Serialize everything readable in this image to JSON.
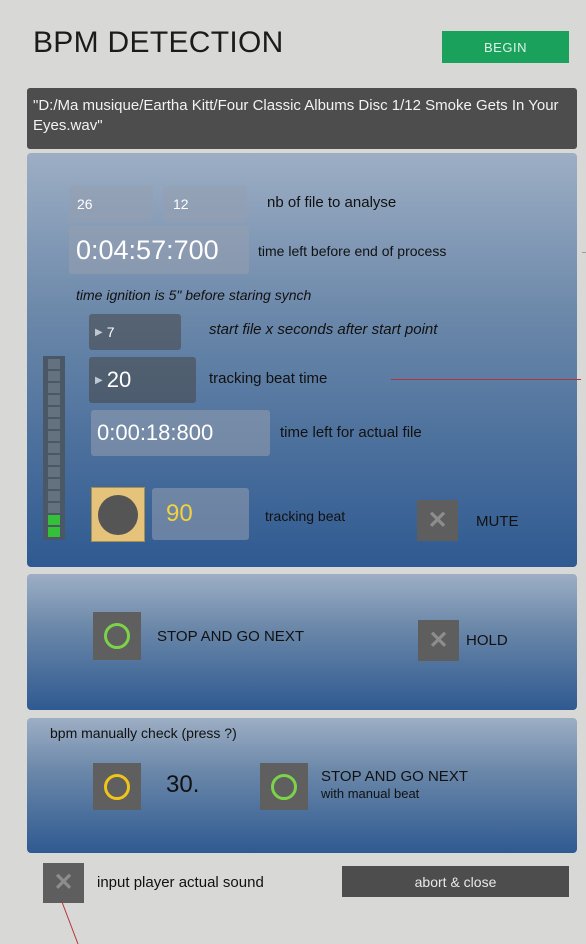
{
  "header": {
    "title": "BPM DETECTION",
    "begin_label": "BEGIN"
  },
  "file_path": "\"D:/Ma musique/Eartha Kitt/Four Classic Albums Disc 1/12 Smoke Gets In Your Eyes.wav\"",
  "analysis": {
    "total_files": "26",
    "files_to_analyse": "12",
    "nb_files_label": "nb of file to analyse",
    "time_left": "0:04:57:700",
    "time_left_label": "time left before end of process",
    "ignition_note": "time ignition is 5\" before staring synch",
    "start_offset": "7",
    "start_offset_label": "start file x seconds after start point",
    "tracking_time": "20",
    "tracking_time_label": "tracking beat time",
    "actual_file_time": "0:00:18:800",
    "actual_file_label": "time left for actual file",
    "tracking_beat_value": "90",
    "tracking_beat_label": "tracking beat",
    "mute_label": "MUTE",
    "meter_level_fraction": 0.125
  },
  "controls": {
    "stop_next_label": "STOP AND GO NEXT",
    "hold_label": "HOLD"
  },
  "manual": {
    "title": "bpm manually check (press ?)",
    "value": "30.",
    "stop_next_line1": "STOP AND GO NEXT",
    "stop_next_line2": "with manual beat"
  },
  "footer": {
    "input_label": "input player actual sound",
    "abort_label": "abort & close"
  },
  "colors": {
    "accent_green": "#1aa25c",
    "beat_yellow": "#f3d23b",
    "ring_green": "#7cd34a",
    "ring_yellow": "#f0c419"
  }
}
